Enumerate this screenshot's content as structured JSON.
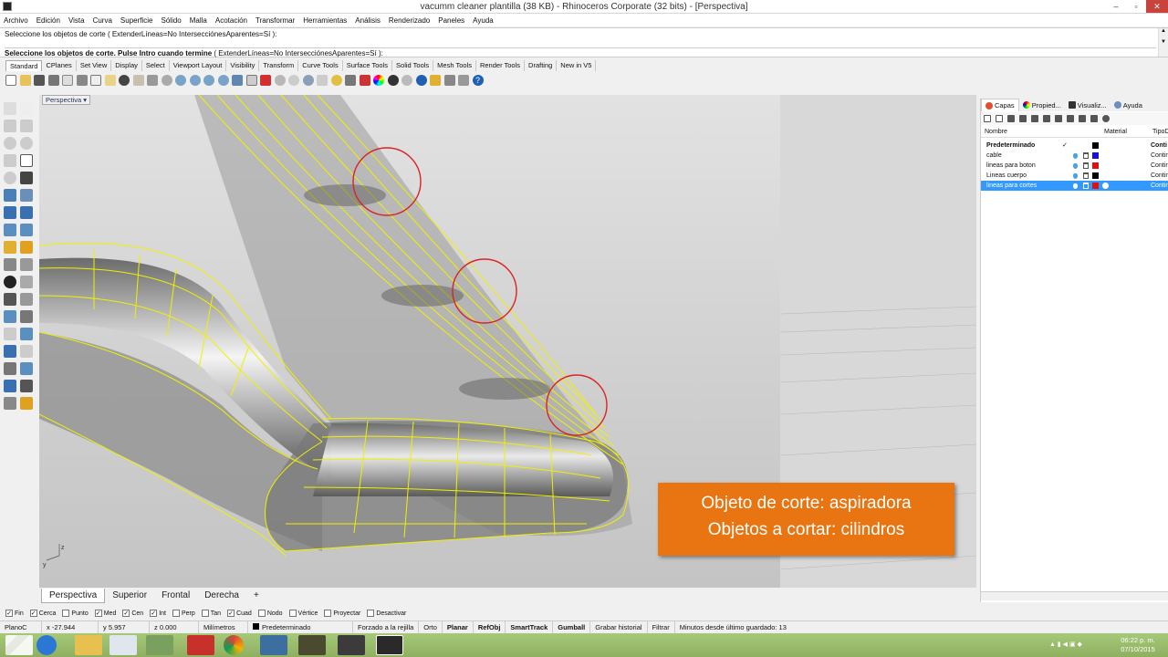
{
  "window": {
    "title": "vacumm cleaner plantilla (38 KB) - Rhinoceros Corporate (32 bits) - [Perspectiva]",
    "minimize": "–",
    "maximize": "▫",
    "close": "✕"
  },
  "menu": [
    "Archivo",
    "Edición",
    "Vista",
    "Curva",
    "Superficie",
    "Sólido",
    "Malla",
    "Acotación",
    "Transformar",
    "Herramientas",
    "Análisis",
    "Renderizado",
    "Paneles",
    "Ayuda"
  ],
  "command": {
    "history_line": "Seleccione los objetos de corte ( ExtenderLíneas=No  IntersecciónesAparentes=Sí ):",
    "prompt_bold": "Seleccione los objetos de corte. Pulse Intro cuando termine",
    "prompt_opts": " ( ExtenderLíneas=No  IntersecciónesAparentes=Sí ):"
  },
  "toolbar_tabs": [
    "Standard",
    "CPlanes",
    "Set View",
    "Display",
    "Select",
    "Viewport Layout",
    "Visibility",
    "Transform",
    "Curve Tools",
    "Surface Tools",
    "Solid Tools",
    "Mesh Tools",
    "Render Tools",
    "Drafting",
    "New in V5"
  ],
  "viewport": {
    "label": "Perspectiva",
    "axis_x": "x",
    "axis_y": "y",
    "axis_z": "z"
  },
  "overlay": {
    "line1": "Objeto de corte: aspiradora",
    "line2": "Objetos a cortar: cilindros"
  },
  "view_tabs": [
    "Perspectiva",
    "Superior",
    "Frontal",
    "Derecha",
    "+"
  ],
  "panel": {
    "tabs": [
      "Capas",
      "Propied...",
      "Visualiz...",
      "Ayuda"
    ],
    "headers": {
      "name": "Nombre",
      "material": "Material",
      "type": "TipoD"
    },
    "layers": [
      {
        "name": "Predeterminado",
        "color": "#000000",
        "type": "Conti",
        "bold": true,
        "current": "✓"
      },
      {
        "name": "cable",
        "color": "#1010e0",
        "type": "Contin"
      },
      {
        "name": "lineas para boton",
        "color": "#e01010",
        "type": "Contin"
      },
      {
        "name": "Lineas cuerpo",
        "color": "#000000",
        "type": "Contin"
      },
      {
        "name": "lineas para cortes",
        "color": "#e01010",
        "type": "Contin",
        "selected": true
      }
    ]
  },
  "osnaps": [
    {
      "label": "Fin",
      "checked": true
    },
    {
      "label": "Cerca",
      "checked": true
    },
    {
      "label": "Punto",
      "checked": false
    },
    {
      "label": "Med",
      "checked": true
    },
    {
      "label": "Cen",
      "checked": true
    },
    {
      "label": "Int",
      "checked": true
    },
    {
      "label": "Perp",
      "checked": false
    },
    {
      "label": "Tan",
      "checked": false
    },
    {
      "label": "Cuad",
      "checked": true
    },
    {
      "label": "Nodo",
      "checked": false
    },
    {
      "label": "Vértice",
      "checked": false
    },
    {
      "label": "Proyectar",
      "checked": false
    },
    {
      "label": "Desactivar",
      "checked": false
    }
  ],
  "status": {
    "cplane": "PlanoC",
    "x": "x -27.944",
    "y": "y 5.957",
    "z": "z 0.000",
    "units": "Milímetros",
    "layer": "Predeterminado",
    "snap": "Forzado a la rejilla",
    "ortho": "Orto",
    "planar": "Planar",
    "refobj": "RefObj",
    "smarttrack": "SmartTrack",
    "gumball": "Gumball",
    "history": "Grabar historial",
    "filter": "Filtrar",
    "saved": "Minutos desde último guardado: 13"
  },
  "clock": {
    "time": "06:22 p. m.",
    "date": "07/10/2015"
  }
}
